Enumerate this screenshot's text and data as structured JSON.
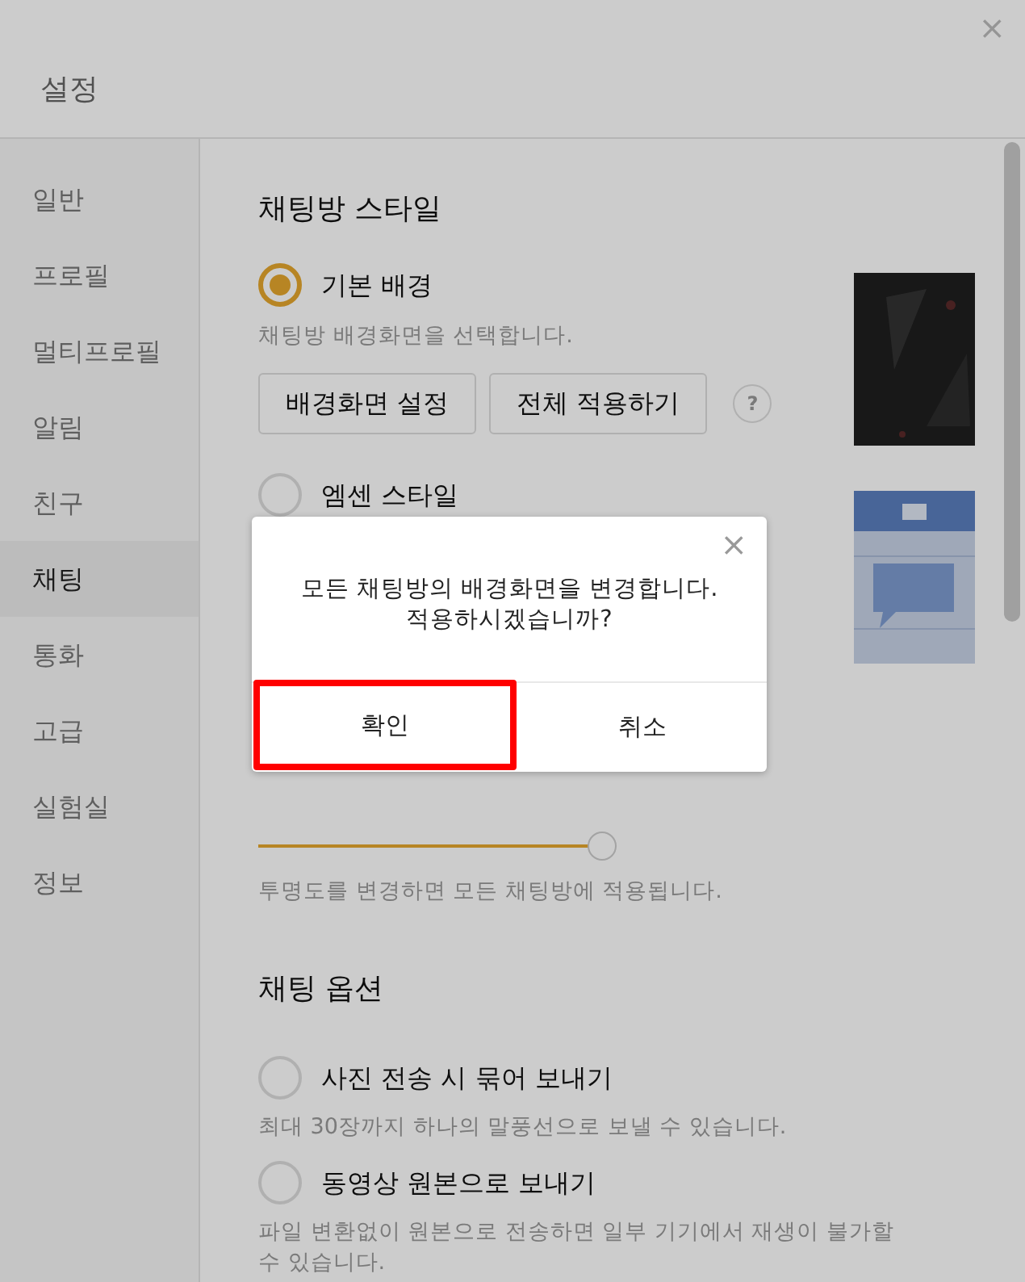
{
  "window": {
    "title": "설정",
    "close": "×"
  },
  "sidebar": {
    "items": [
      {
        "label": "일반",
        "selected": false
      },
      {
        "label": "프로필",
        "selected": false
      },
      {
        "label": "멀티프로필",
        "selected": false
      },
      {
        "label": "알림",
        "selected": false
      },
      {
        "label": "친구",
        "selected": false
      },
      {
        "label": "채팅",
        "selected": true
      },
      {
        "label": "통화",
        "selected": false
      },
      {
        "label": "고급",
        "selected": false
      },
      {
        "label": "실험실",
        "selected": false
      },
      {
        "label": "정보",
        "selected": false
      }
    ]
  },
  "chat_room_style": {
    "heading": "채팅방 스타일",
    "options": [
      {
        "label": "기본 배경",
        "selected": true,
        "description": "채팅방 배경화면을 선택합니다.",
        "buttons": [
          "배경화면 설정",
          "전체 적용하기"
        ],
        "help": "?"
      },
      {
        "label": "엠센 스타일",
        "selected": false
      }
    ],
    "opacity": {
      "level": 1,
      "description": "투명도를 변경하면 모든 채팅방에 적용됩니다."
    }
  },
  "chat_options": {
    "heading": "채팅 옵션",
    "options": [
      {
        "label": "사진 전송 시 묶어 보내기",
        "checked": false,
        "description": "최대 30장까지 하나의 말풍선으로 보낼 수 있습니다."
      },
      {
        "label": "동영상 원본으로 보내기",
        "checked": false,
        "description": "파일 변환없이 원본으로 전송하면 일부 기기에서 재생이 불가할 수 있습니다."
      }
    ]
  },
  "dialog": {
    "close": "×",
    "message_lines": [
      "모든 채팅방의 배경화면을 변경합니다.",
      "적용하시겠습니까?"
    ],
    "buttons": [
      {
        "label": "확인",
        "highlighted": true
      },
      {
        "label": "취소",
        "highlighted": false
      }
    ]
  }
}
